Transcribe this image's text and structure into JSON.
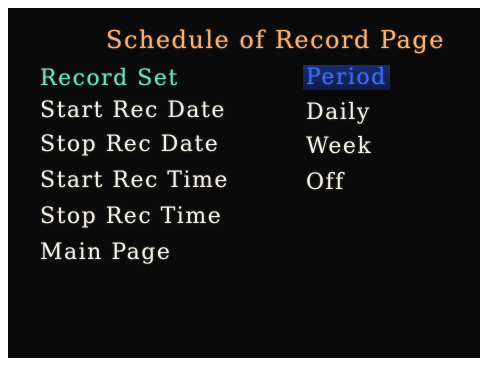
{
  "page": {
    "title": "Schedule of Record Page"
  },
  "menu": {
    "items": [
      {
        "label": "Record Set"
      },
      {
        "label": "Start Rec Date"
      },
      {
        "label": "Stop Rec Date"
      },
      {
        "label": "Start Rec Time"
      },
      {
        "label": "Stop Rec Time"
      },
      {
        "label": "Main Page"
      }
    ],
    "selected_label": "Record Set"
  },
  "options": {
    "items": [
      {
        "label": "Period"
      },
      {
        "label": "Daily"
      },
      {
        "label": "Week"
      },
      {
        "label": "Off"
      }
    ],
    "highlighted_label": "Period"
  },
  "colors": {
    "background": "#0a0a0a",
    "title": "#f0b37d",
    "selected_menu_text": "#72e0b6",
    "highlighted_option_text": "#3b6cf2",
    "default_text": "#f5f0e6"
  }
}
